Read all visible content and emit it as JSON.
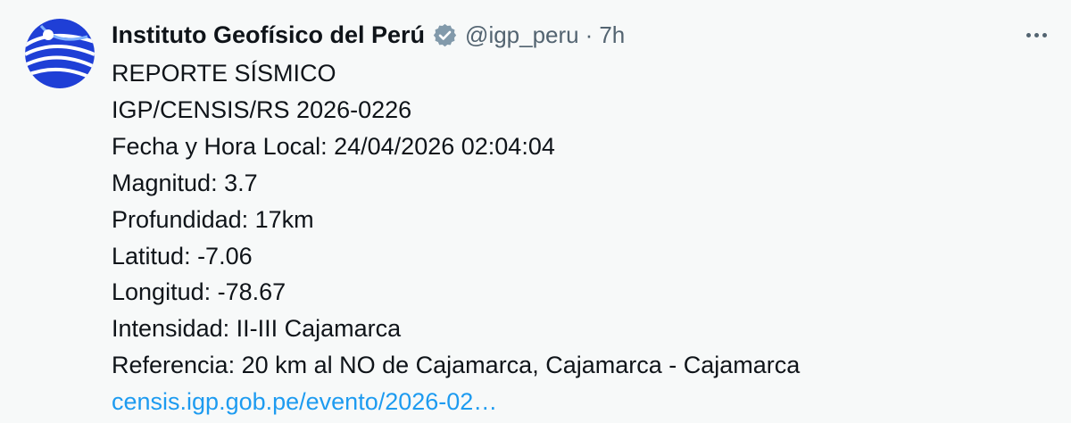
{
  "author": {
    "name": "Instituto Geofísico del Perú",
    "handle": "@igp_peru",
    "separator": "·",
    "time": "7h",
    "verified_icon": "verified-badge-icon",
    "avatar_icon": "igp-logo"
  },
  "menu": {
    "icon": "more-horizontal-icon"
  },
  "post": {
    "lines": [
      "REPORTE SÍSMICO",
      "IGP/CENSIS/RS 2026-0226",
      "Fecha y Hora Local: 24/04/2026 02:04:04",
      "Magnitud: 3.7",
      "Profundidad: 17km",
      "Latitud: -7.06",
      "Longitud: -78.67",
      "Intensidad: II-III Cajamarca",
      "Referencia: 20 km al NO de Cajamarca, Cajamarca - Cajamarca"
    ],
    "link": "censis.igp.gob.pe/evento/2026-02…"
  },
  "colors": {
    "background": "#f7f9f9",
    "text": "#0f1419",
    "secondary": "#536471",
    "link": "#1d9bf0",
    "avatar_blue": "#1f3fd6"
  }
}
